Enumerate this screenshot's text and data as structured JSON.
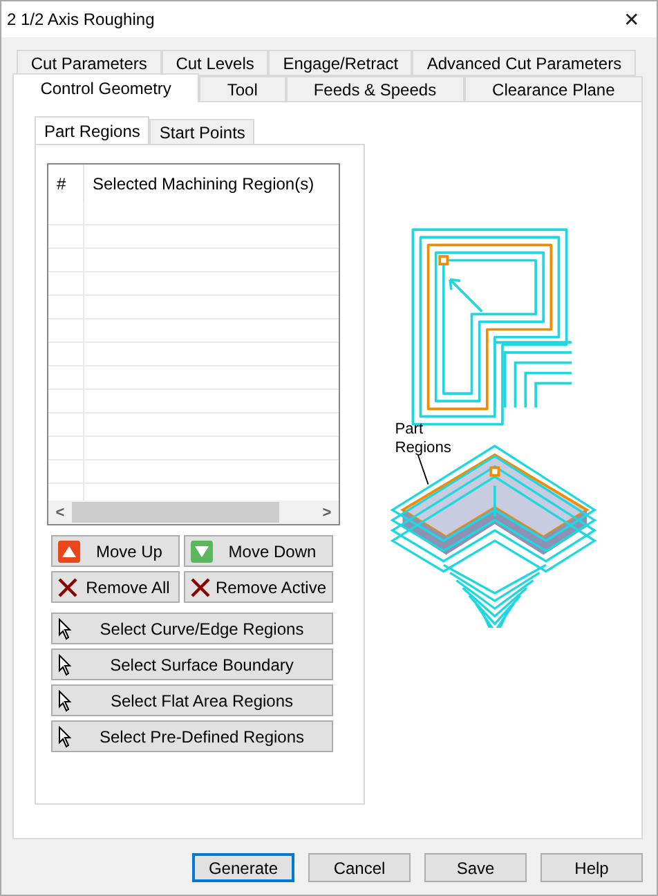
{
  "window": {
    "title": "2 1/2 Axis Roughing",
    "close": "✕"
  },
  "tab_rows": [
    [
      {
        "label": "Cut Parameters",
        "selected": false
      },
      {
        "label": "Cut Levels",
        "selected": false
      },
      {
        "label": "Engage/Retract",
        "selected": false
      },
      {
        "label": "Advanced Cut Parameters",
        "selected": false
      }
    ],
    [
      {
        "label": "Control Geometry",
        "selected": true
      },
      {
        "label": "Tool",
        "selected": false
      },
      {
        "label": "Feeds & Speeds",
        "selected": false
      },
      {
        "label": "Clearance Plane",
        "selected": false
      }
    ]
  ],
  "subtabs": [
    {
      "label": "Part Regions",
      "selected": true
    },
    {
      "label": "Start Points",
      "selected": false
    }
  ],
  "table": {
    "columns": [
      "#",
      "Selected Machining Region(s)"
    ],
    "scroll_left": "<",
    "scroll_right": ">"
  },
  "pair_buttons": [
    {
      "label": "Move Up",
      "kind": "up"
    },
    {
      "label": "Move Down",
      "kind": "down"
    },
    {
      "label": "Remove All",
      "kind": "remove"
    },
    {
      "label": "Remove Active",
      "kind": "remove"
    }
  ],
  "select_buttons": [
    {
      "label": "Select Curve/Edge Regions",
      "kind": "select"
    },
    {
      "label": "Select Surface Boundary",
      "kind": "select"
    },
    {
      "label": "Select Flat Area Regions",
      "kind": "select"
    },
    {
      "label": "Select Pre-Defined Regions",
      "kind": "select"
    }
  ],
  "illustration": {
    "callout": "Part\nRegions"
  },
  "footer_buttons": [
    {
      "label": "Generate",
      "default": true
    },
    {
      "label": "Cancel",
      "default": false
    },
    {
      "label": "Save",
      "default": false
    },
    {
      "label": "Help",
      "default": false
    }
  ]
}
